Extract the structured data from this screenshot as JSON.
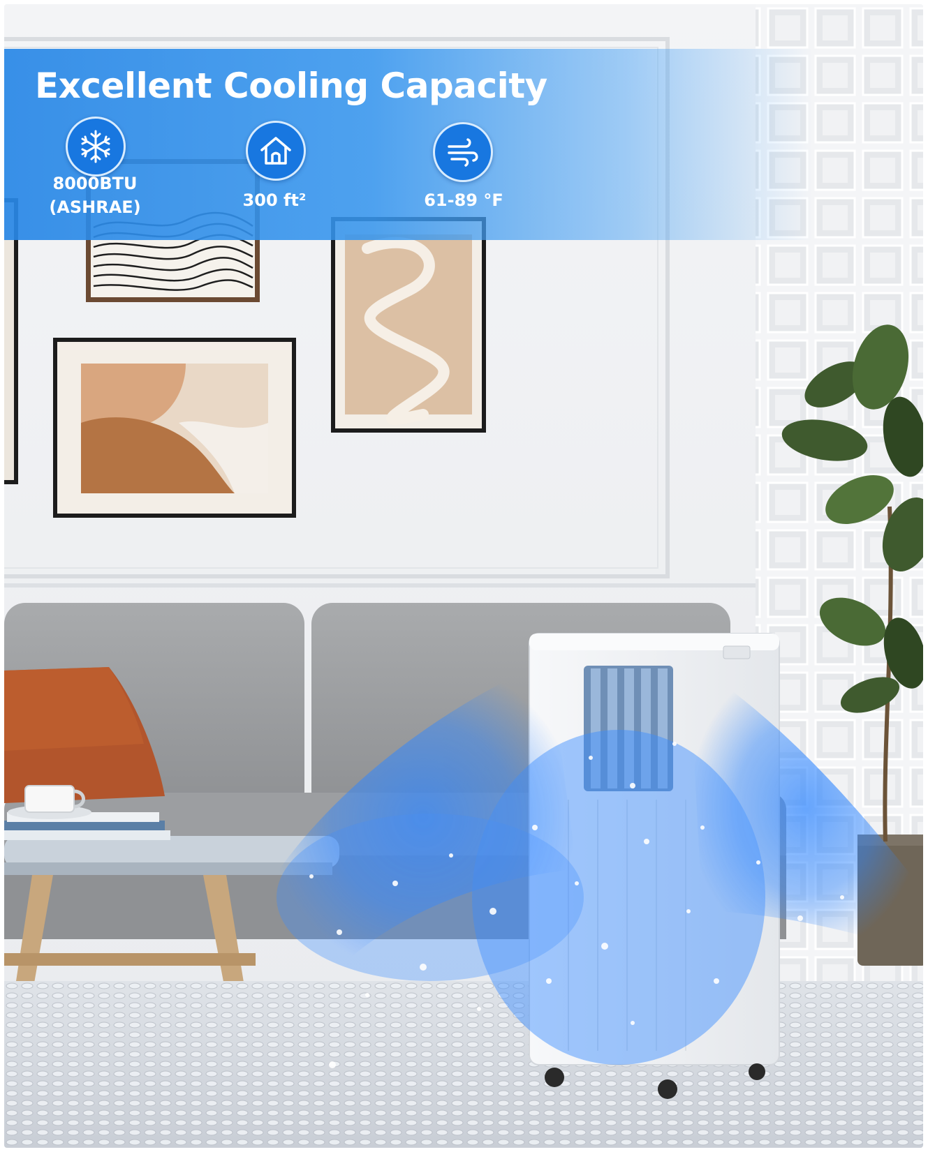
{
  "banner": {
    "title": "Excellent Cooling Capacity",
    "specs": [
      {
        "icon": "snowflake-icon",
        "line1": "8000BTU",
        "line2": "(ASHRAE)"
      },
      {
        "icon": "house-icon",
        "line1": "300 ft²"
      },
      {
        "icon": "wind-icon",
        "line1": "61-89 °F"
      }
    ],
    "accent_color": "#1877e0"
  }
}
